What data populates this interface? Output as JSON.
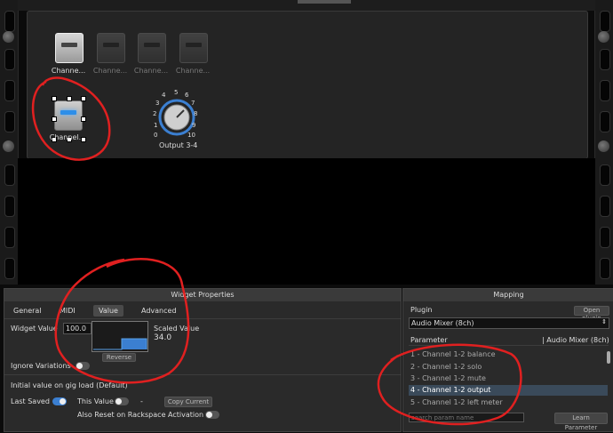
{
  "rack": {
    "widgets": [
      {
        "label": "Channe...",
        "state": "active"
      },
      {
        "label": "Channe...",
        "state": "dim"
      },
      {
        "label": "Channe...",
        "state": "dim"
      },
      {
        "label": "Channe...",
        "state": "dim"
      }
    ],
    "selected_widget": {
      "label": "Channel..."
    },
    "knob": {
      "label": "Output 3-4",
      "scale_numbers": [
        "0",
        "1",
        "2",
        "3",
        "4",
        "5",
        "6",
        "7",
        "8",
        "9",
        "10"
      ]
    }
  },
  "widget_properties": {
    "title": "Widget Properties",
    "tabs": [
      "General",
      "MIDI",
      "Value",
      "Advanced"
    ],
    "active_tab": "Value",
    "widget_value_label": "Widget Value",
    "widget_value": "100.0",
    "scaled_value_label": "Scaled Value",
    "scaled_value": "34.0",
    "reverse_label": "Reverse",
    "ignore_variations_label": "Ignore Variations",
    "initial_value_label": "Initial value on gig load (Default)",
    "last_saved_label": "Last Saved",
    "this_value_label": "This Value",
    "this_value_dash": "-",
    "copy_current_label": "Copy Current",
    "also_reset_label": "Also Reset on Rackspace Activation"
  },
  "mapping": {
    "title": "Mapping",
    "plugin_label": "Plugin",
    "open_plugin_label": "Open plugin",
    "plugin_selected": "Audio Mixer (8ch)",
    "parameter_header": "Parameter",
    "parameter_header_right": "| Audio Mixer (8ch)",
    "parameters": [
      "1 - Channel 1-2 balance",
      "2 - Channel 1-2 solo",
      "3 - Channel 1-2 mute",
      "4 - Channel 1-2 output",
      "5 - Channel 1-2 left meter"
    ],
    "selected_parameter_index": 3,
    "search_placeholder": "search param name",
    "learn_parameter_label": "Learn Parameter"
  },
  "colors": {
    "accent": "#3b7fd1",
    "annotation": "#e02020"
  }
}
